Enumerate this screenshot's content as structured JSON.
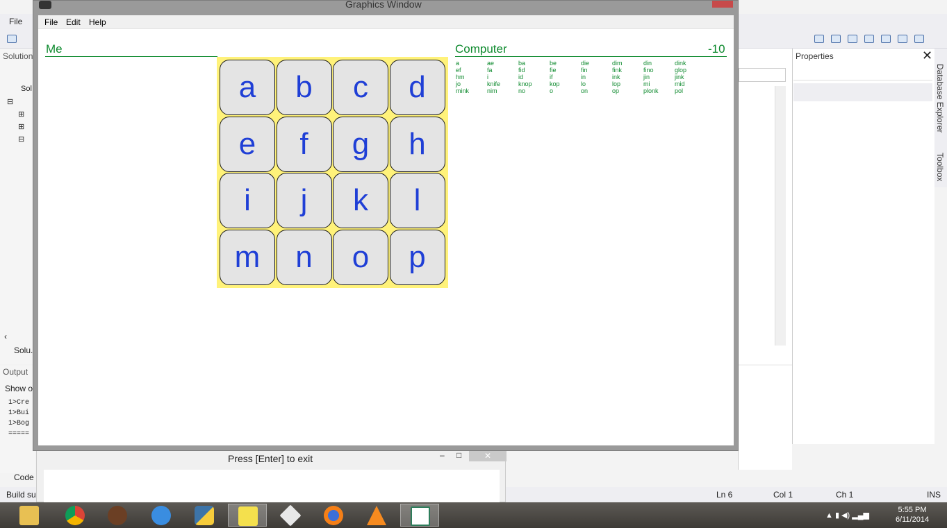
{
  "ide": {
    "menu_file": "File",
    "solution_header": "Solution",
    "tree_item": "Sol",
    "solution_tab": "Solu.",
    "output_header": "Output",
    "show_output": "Show o",
    "output_lines": [
      "1>Cre",
      "1>Bui",
      "1>Bog",
      "====="
    ],
    "code_tab": "Code",
    "build_status": "Build su",
    "status": {
      "ln": "Ln 6",
      "col": "Col 1",
      "ch": "Ch 1",
      "ins": "INS"
    },
    "properties_header": "Properties",
    "database_explorer": "Database Explorer",
    "toolbox": "Toolbox"
  },
  "console": {
    "title": "Press [Enter] to exit"
  },
  "graphics_window": {
    "title": "Graphics Window",
    "menu": [
      "File",
      "Edit",
      "Help"
    ],
    "player": {
      "name": "Me",
      "score": ""
    },
    "computer": {
      "name": "Computer",
      "score": "-10"
    },
    "board": [
      [
        "a",
        "b",
        "c",
        "d"
      ],
      [
        "e",
        "f",
        "g",
        "h"
      ],
      [
        "i",
        "j",
        "k",
        "l"
      ],
      [
        "m",
        "n",
        "o",
        "p"
      ]
    ],
    "computer_words": [
      [
        "a",
        "ef",
        "hm",
        "jo",
        "mink"
      ],
      [
        "ae",
        "fa",
        "i",
        "knife",
        "nim"
      ],
      [
        "ba",
        "fid",
        "id",
        "knop",
        "no"
      ],
      [
        "be",
        "fie",
        "if",
        "kop",
        "o"
      ],
      [
        "die",
        "fin",
        "in",
        "lo",
        "on"
      ],
      [
        "dim",
        "fink",
        "ink",
        "lop",
        "op"
      ],
      [
        "din",
        "fino",
        "jin",
        "mi",
        "plonk"
      ],
      [
        "dink",
        "glop",
        "jink",
        "mid",
        "pol"
      ]
    ]
  },
  "taskbar": {
    "time": "5:55 PM",
    "date": "6/11/2014",
    "apps": [
      "file-explorer",
      "chrome",
      "app-brown",
      "itunes",
      "python",
      "visual-studio",
      "unity",
      "firefox",
      "vlc",
      "graphics-window"
    ]
  },
  "colors": {
    "letter": "#1f3fd6",
    "board_bg": "#fff27a",
    "tile_bg": "#e4e4e4",
    "player_green": "#0e8a2e"
  }
}
